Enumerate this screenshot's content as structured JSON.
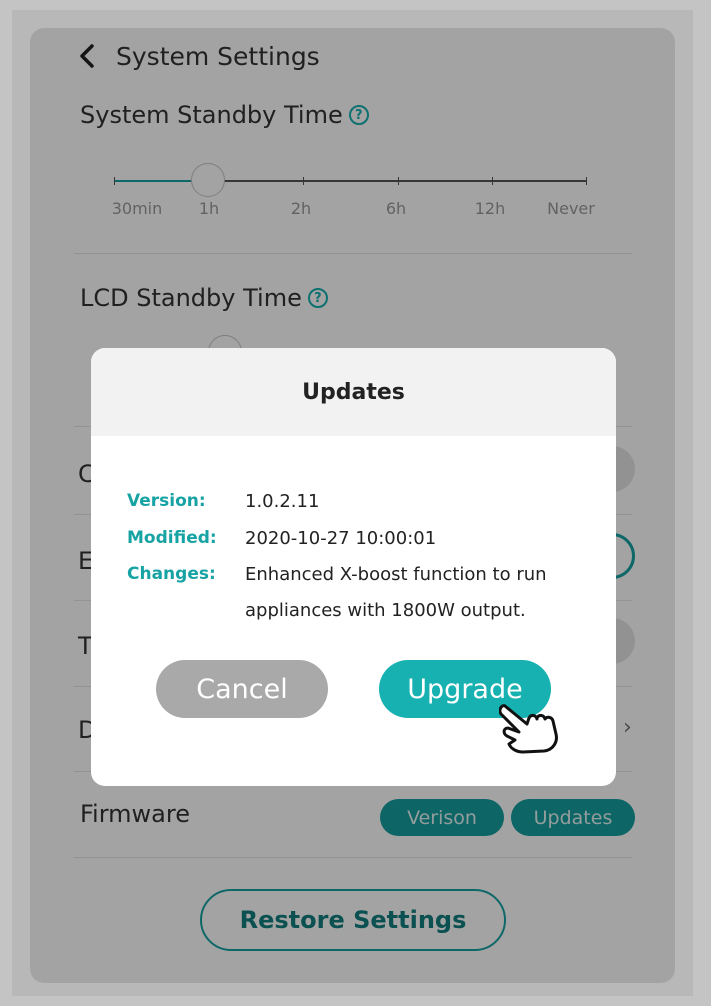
{
  "header": {
    "title": "System Settings"
  },
  "system_standby": {
    "title": "System Standby Time",
    "options": [
      "30min",
      "1h",
      "2h",
      "6h",
      "12h",
      "Never"
    ],
    "selected": "1h"
  },
  "lcd_standby": {
    "title": "LCD Standby Time"
  },
  "hidden_rows": [
    "C",
    "E",
    "T",
    "D"
  ],
  "firmware": {
    "label": "Firmware",
    "version_button": "Verison",
    "updates_button": "Updates"
  },
  "restore_button": "Restore Settings",
  "dialog": {
    "title": "Updates",
    "version_label": "Version:",
    "version_value": "1.0.2.11",
    "modified_label": "Modified:",
    "modified_value": "2020-10-27 10:00:01",
    "changes_label": "Changes:",
    "changes_value": "Enhanced X-boost function to run appliances with 1800W output.",
    "cancel_label": "Cancel",
    "upgrade_label": "Upgrade"
  },
  "colors": {
    "accent": "#17b1b1",
    "accent_dark": "#159e9e",
    "cancel_gray": "#a9a9a9"
  },
  "icons": [
    "back-chevron-icon",
    "question-circle-icon",
    "chevron-right-icon",
    "pointing-hand-icon"
  ]
}
